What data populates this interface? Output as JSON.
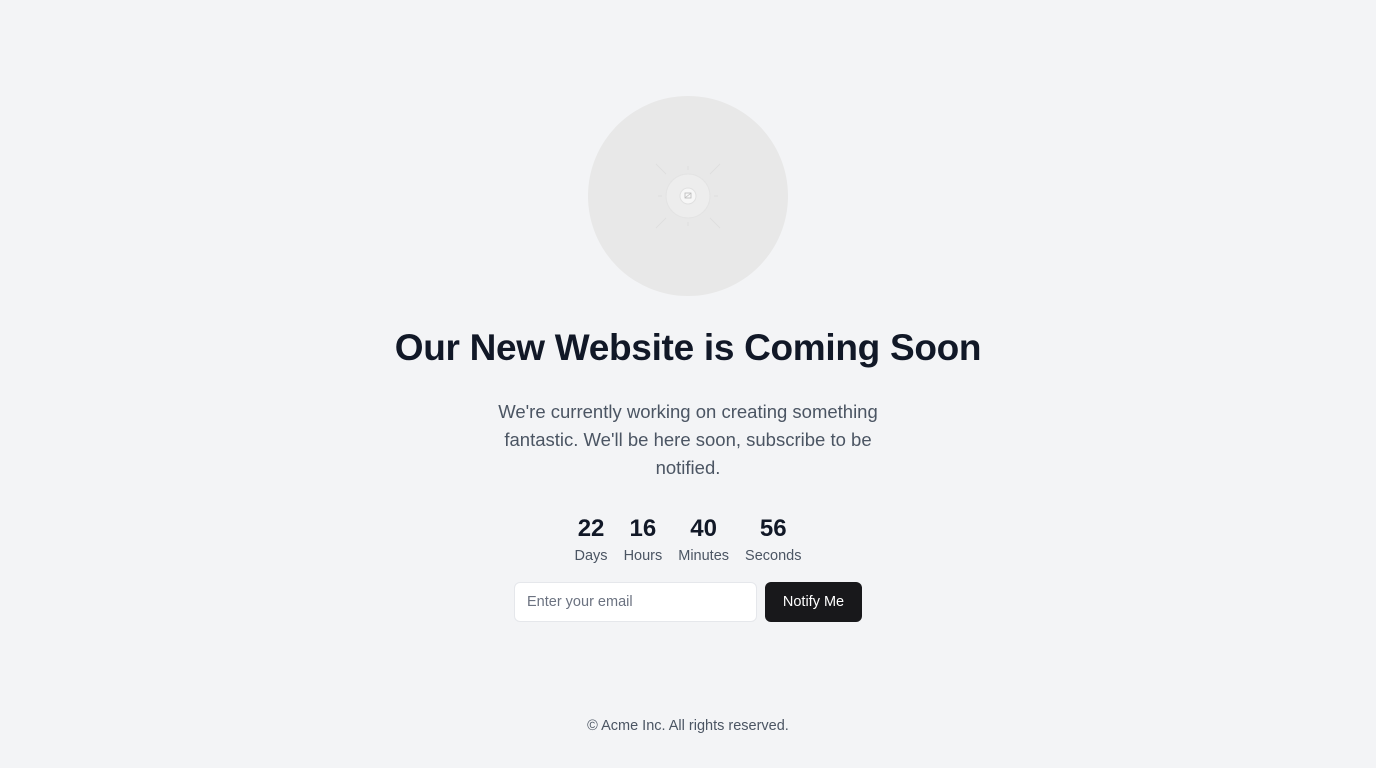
{
  "hero": {
    "image_icon": "image-placeholder-icon"
  },
  "title": "Our New Website is Coming Soon",
  "description": "We're currently working on creating something fantastic. We'll be here soon, subscribe to be notified.",
  "countdown": [
    {
      "value": "22",
      "label": "Days"
    },
    {
      "value": "16",
      "label": "Hours"
    },
    {
      "value": "40",
      "label": "Minutes"
    },
    {
      "value": "56",
      "label": "Seconds"
    }
  ],
  "form": {
    "email_placeholder": "Enter your email",
    "email_value": "",
    "button_label": "Notify Me"
  },
  "footer": "© Acme Inc. All rights reserved.",
  "colors": {
    "background": "#f3f4f6",
    "heading": "#111827",
    "body_text": "#4b5563",
    "button_bg": "#18181b",
    "button_text": "#ffffff"
  }
}
